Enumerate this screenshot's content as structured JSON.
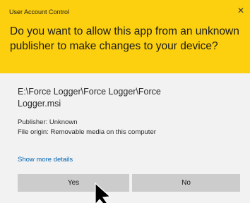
{
  "window": {
    "title": "User Account Control",
    "close_glyph": "✕",
    "close_icon": "close-icon"
  },
  "prompt": {
    "question": "Do you want to allow this app from an unknown publisher to make changes to your device?"
  },
  "details": {
    "file_path": "E:\\Force Logger\\Force Logger\\Force Logger.msi",
    "publisher": "Publisher: Unknown",
    "file_origin": "File origin: Removable media on this computer",
    "more_details_link": "Show more details"
  },
  "buttons": {
    "yes_label": "Yes",
    "no_label": "No"
  },
  "colors": {
    "header_bg": "#fcd00f",
    "body_bg": "#f2f2f2",
    "button_bg": "#cccccc",
    "link": "#0063b1"
  },
  "cursor": {
    "icon": "mouse-pointer-icon"
  }
}
